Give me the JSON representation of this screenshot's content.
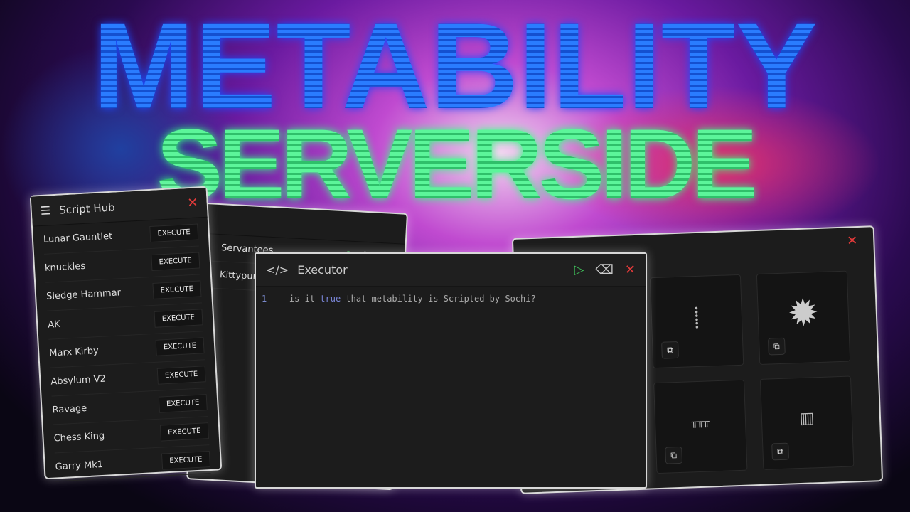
{
  "thumbnail": {
    "title_line1": "METABILITY",
    "title_line2": "SERVERSIDE"
  },
  "script_hub": {
    "title": "Script Hub",
    "menu_icon": "hamburger-icon",
    "close_icon": "close-icon",
    "items": [
      {
        "name": "Lunar Gauntlet",
        "button": "EXECUTE"
      },
      {
        "name": "knuckles",
        "button": "EXECUTE"
      },
      {
        "name": "Sledge Hammar",
        "button": "EXECUTE"
      },
      {
        "name": "AK",
        "button": "EXECUTE"
      },
      {
        "name": "Marx Kirby",
        "button": "EXECUTE"
      },
      {
        "name": "Absylum V2",
        "button": "EXECUTE"
      },
      {
        "name": "Ravage",
        "button": "EXECUTE"
      },
      {
        "name": "Chess King",
        "button": "EXECUTE"
      },
      {
        "name": "Garry Mk1",
        "button": "EXECUTE"
      }
    ]
  },
  "server_panel": {
    "items": [
      "Servantees",
      "Kittypur"
    ]
  },
  "executor": {
    "title": "Executor",
    "icon": "code-icon",
    "line_number": "1",
    "code_prefix": "-- is it ",
    "code_keyword": "true",
    "code_suffix": " that metability is Scripted by Sochi?",
    "actions": {
      "run": "play-icon",
      "clear": "eraser-icon",
      "close": "close-icon"
    },
    "colors": {
      "run": "#3fbf5a",
      "close": "#e23a3a",
      "keyword": "#7a86d8"
    }
  },
  "models_panel": {
    "items": [
      "staff",
      "saw-blade",
      "rail",
      "cage"
    ],
    "copy_icon": "copy-icon"
  }
}
